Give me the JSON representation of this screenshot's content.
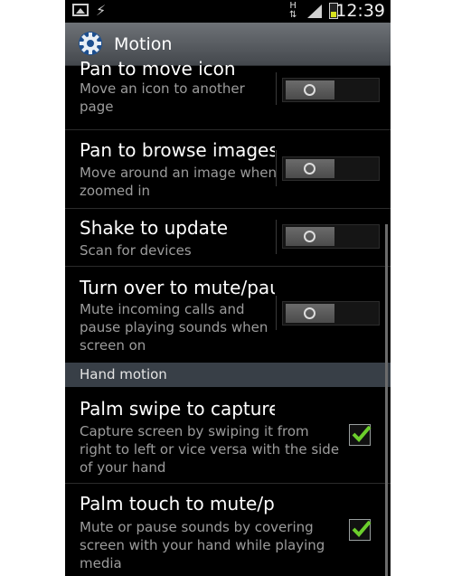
{
  "status_bar": {
    "time": "12:39",
    "network_type": "H",
    "icons": [
      "gallery-icon",
      "usb-icon",
      "signal-icon",
      "battery-charging-icon"
    ]
  },
  "action_bar": {
    "title": "Motion",
    "icon": "gear-icon"
  },
  "toggle_items": [
    {
      "title": "Pan to move icon",
      "summary": "Move an icon to another page",
      "state": "off"
    },
    {
      "title": "Pan to browse images",
      "summary": "Move around an image when zoomed in",
      "state": "off"
    },
    {
      "title": "Shake to update",
      "summary": "Scan for devices",
      "state": "off"
    },
    {
      "title": "Turn over to mute/pause",
      "summary": "Mute incoming calls and pause playing sounds when screen on",
      "state": "off"
    }
  ],
  "section": {
    "label": "Hand motion"
  },
  "check_items": [
    {
      "title": "Palm swipe to capture",
      "summary": "Capture screen by swiping it from right to left or vice versa with the side of your hand",
      "checked": true
    },
    {
      "title": "Palm touch to mute/pause",
      "summary": "Mute or pause sounds by covering screen with your hand while playing media",
      "checked": true
    }
  ],
  "colors": {
    "background": "#000000",
    "action_bar": "#5a5e63",
    "section_header": "#383f47",
    "check_mark": "#6ccf2c",
    "summary_text": "#9c9c9c"
  }
}
